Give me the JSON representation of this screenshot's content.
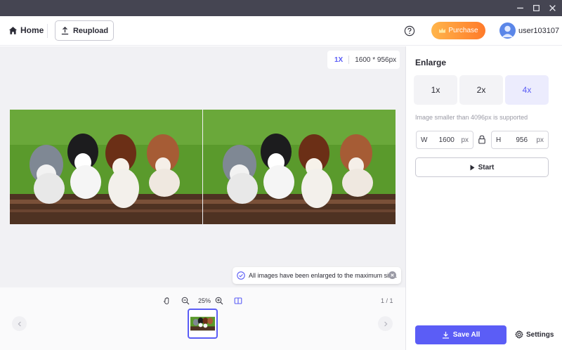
{
  "window": {
    "minimize_icon": "minimize-icon",
    "maximize_icon": "maximize-icon",
    "close_icon": "close-icon"
  },
  "header": {
    "home_label": "Home",
    "reupload_label": "Reupload",
    "purchase_label": "Purchase",
    "username": "user103107"
  },
  "canvas": {
    "scale_factor": "1X",
    "image_size": "1600 * 956px",
    "toast_message": "All images have been enlarged to the maximum size."
  },
  "viewer": {
    "zoom": "25%",
    "page_index": "1 / 1"
  },
  "enlarge": {
    "title": "Enlarge",
    "scales": [
      {
        "label": "1x",
        "selected": false
      },
      {
        "label": "2x",
        "selected": false
      },
      {
        "label": "4x",
        "selected": true
      }
    ],
    "hint": "Image smaller than 4096px is supported",
    "width": {
      "label": "W",
      "value": "1600",
      "unit": "px"
    },
    "height": {
      "label": "H",
      "value": "956",
      "unit": "px"
    },
    "start_label": "Start"
  },
  "footer": {
    "save_all_label": "Save All",
    "settings_label": "Settings"
  },
  "colors": {
    "accent": "#5b5df6",
    "titlebar": "#454552",
    "purchase_start": "#ffb54a",
    "purchase_end": "#ff7a2a"
  }
}
